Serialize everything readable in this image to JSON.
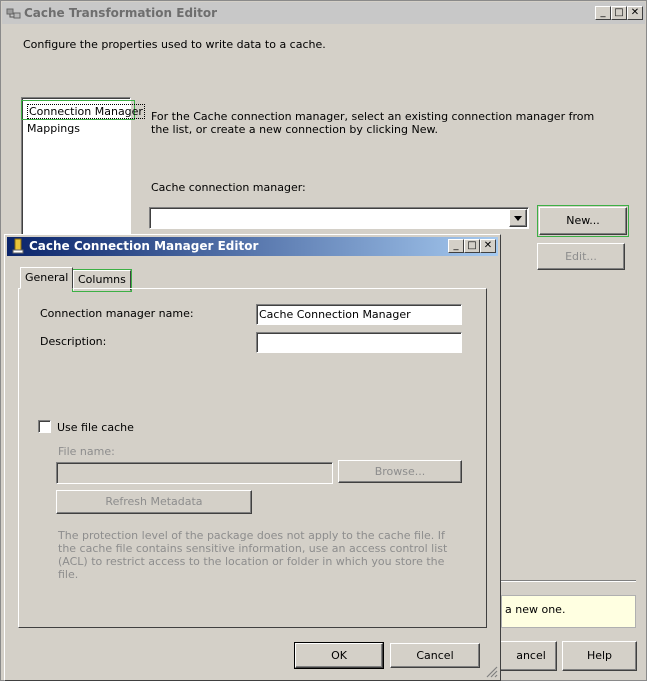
{
  "outer_window": {
    "title": "Cache Transformation Editor",
    "description": "Configure the properties used to write data to a cache.",
    "nav_items": [
      "Connection Manager",
      "Mappings"
    ],
    "instructions": "For the Cache connection manager, select an existing connection manager from the list, or create a new connection by clicking New.",
    "connection_label": "Cache connection manager:",
    "connection_value": "",
    "new_button": "New...",
    "edit_button": "Edit...",
    "message_fragment": "a new one.",
    "cancel_button_fragment": "ancel",
    "help_button": "Help",
    "controls": {
      "minimize": "_",
      "maximize": "□",
      "close": "✕"
    }
  },
  "inner_dialog": {
    "title": "Cache Connection Manager Editor",
    "tabs": [
      "General",
      "Columns"
    ],
    "name_label": "Connection manager name:",
    "name_value": "Cache Connection Manager",
    "description_label": "Description:",
    "description_value": "",
    "use_file_cache_label": "Use file cache",
    "use_file_cache_checked": false,
    "file_name_label": "File name:",
    "file_name_value": "",
    "browse_button": "Browse...",
    "refresh_button": "Refresh Metadata",
    "note": "The protection level of the package does not apply to the cache file. If the cache file contains sensitive information, use an access control list (ACL) to restrict access to the location or folder in which you store the file.",
    "ok_button": "OK",
    "cancel_button": "Cancel",
    "controls": {
      "minimize": "_",
      "maximize": "□",
      "close": "✕"
    }
  },
  "colors": {
    "active_title_start": "#0a246a",
    "active_title_end": "#a6caf0",
    "focus_outline": "#3cb045",
    "disabled_text": "#8d8d8d"
  }
}
